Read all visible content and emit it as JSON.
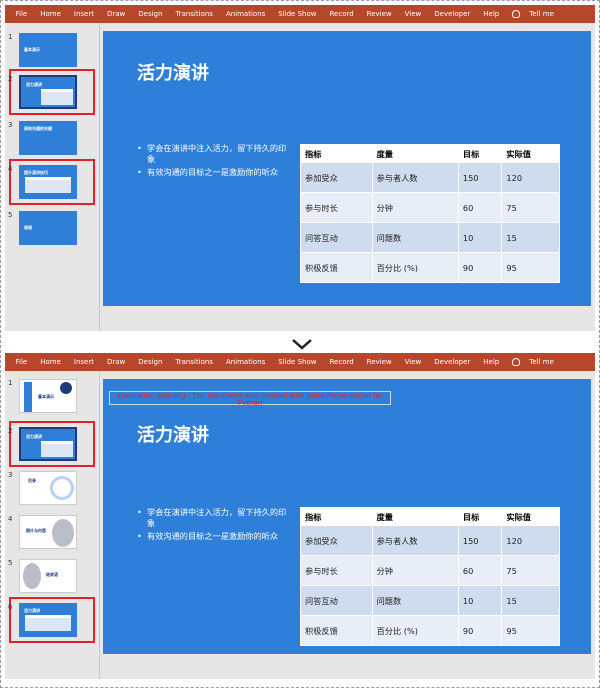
{
  "ribbon": {
    "tabs": [
      "File",
      "Home",
      "Insert",
      "Draw",
      "Design",
      "Transitions",
      "Animations",
      "Slide Show",
      "Record",
      "Review",
      "View",
      "Developer",
      "Help"
    ],
    "tell_me": "Tell me"
  },
  "top": {
    "thumbs": [
      {
        "num": "1",
        "title": "基本演示"
      },
      {
        "num": "2",
        "title": "活力演讲"
      },
      {
        "num": "3",
        "title": "高效沟通的关键"
      },
      {
        "num": "4",
        "title": "提升演讲技巧"
      },
      {
        "num": "5",
        "title": "谢谢"
      }
    ]
  },
  "bottom": {
    "thumbs": [
      {
        "num": "1",
        "title": "基本演示"
      },
      {
        "num": "2",
        "title": "活力演讲"
      },
      {
        "num": "3",
        "title": "目录"
      },
      {
        "num": "4",
        "title": "图片与内容"
      },
      {
        "num": "5",
        "title": "结束语"
      },
      {
        "num": "6",
        "title": "活力演讲"
      }
    ],
    "watermark": "Evaluation Warning : The document was created with Spire.Presentation for Python"
  },
  "slide": {
    "title": "活力演讲",
    "bullets": [
      "学会在演讲中注入活力，留下持久的印象",
      "有效沟通的目标之一是激励你的听众"
    ],
    "table": {
      "headers": [
        "指标",
        "度量",
        "目标",
        "实际值"
      ],
      "rows": [
        [
          "参加受众",
          "参与者人数",
          "150",
          "120"
        ],
        [
          "参与时长",
          "分钟",
          "60",
          "75"
        ],
        [
          "问答互动",
          "问题数",
          "10",
          "15"
        ],
        [
          "积极反馈",
          "百分比 (%)",
          "90",
          "95"
        ]
      ]
    }
  },
  "colors": {
    "ribbon": "#b7472a",
    "slide": "#2e7fd9",
    "selection": "#e0202a"
  },
  "icons": {
    "separator": "chevron-down-icon",
    "tell_me": "lightbulb-icon"
  }
}
